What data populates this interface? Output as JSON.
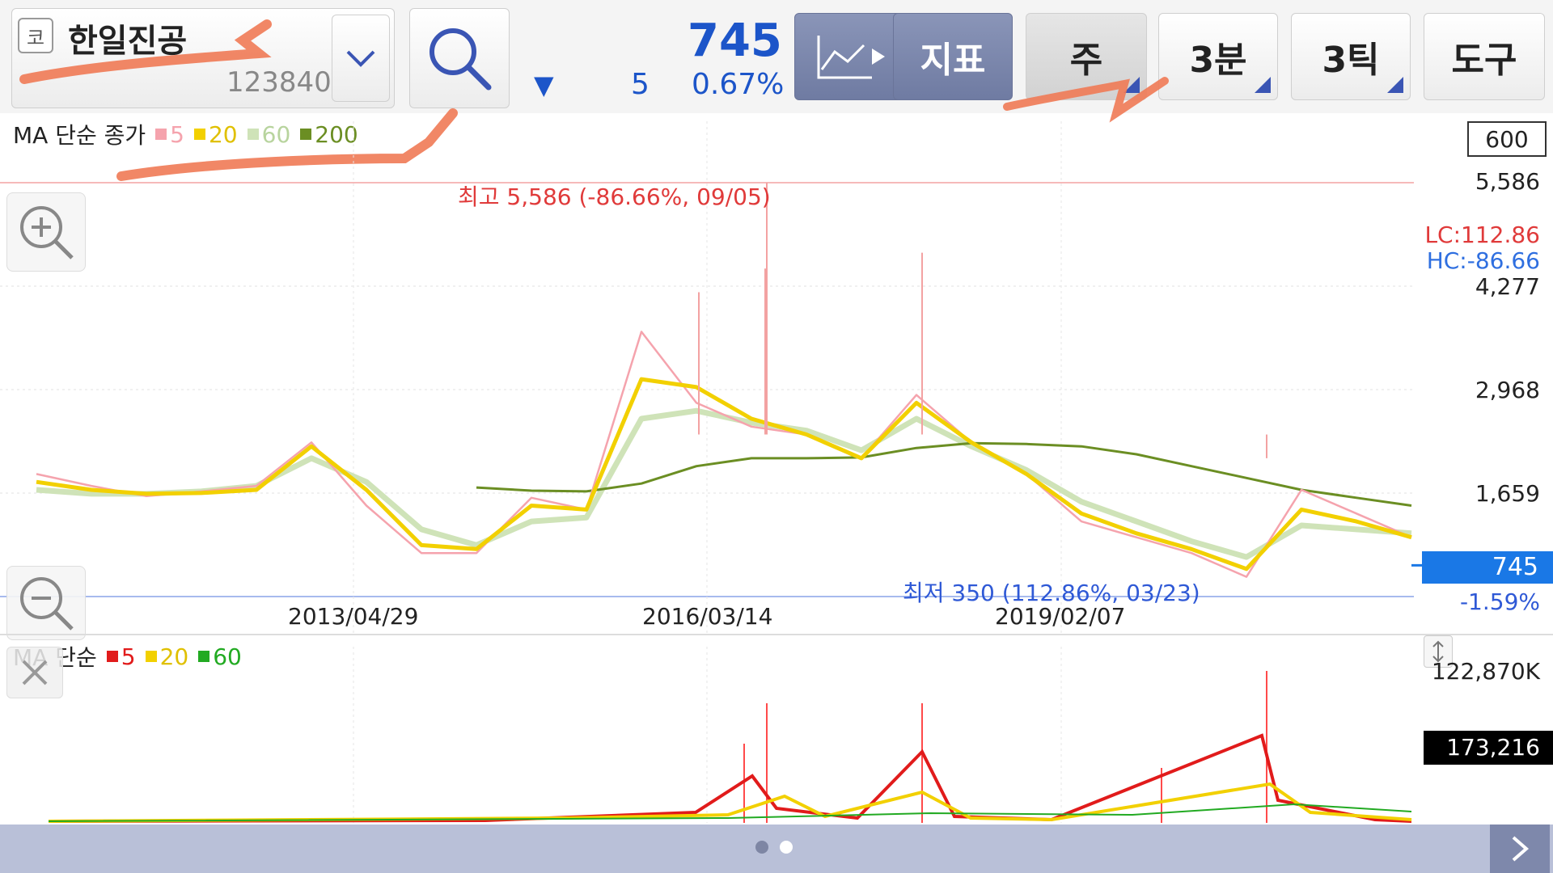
{
  "toolbar": {
    "market_badge": "코",
    "stock_name": "한일진공",
    "stock_code": "123840",
    "price": "745",
    "change_arrow": "▼",
    "change_value": "5",
    "change_pct": "0.67%",
    "buttons": {
      "indicator": "지표",
      "period_week": "주",
      "minute": "3분",
      "tick": "3틱",
      "tools": "도구"
    }
  },
  "price_chart": {
    "legend": {
      "title": "MA 단순 종가",
      "items": [
        {
          "label": "5",
          "color": "#f5a3ad"
        },
        {
          "label": "20",
          "color": "#f2d000"
        },
        {
          "label": "60",
          "color": "#cfe3b8"
        },
        {
          "label": "200",
          "color": "#6b8e23"
        }
      ]
    },
    "count_box": "600",
    "high_label": "최고 5,586 (-86.66%, 09/05)",
    "low_label": "최저 350 (112.86%, 03/23)",
    "lc_label": "LC:112.86",
    "hc_label": "HC:-86.66",
    "y_ticks": [
      "5,586",
      "4,277",
      "2,968",
      "1,659"
    ],
    "current_price_tag": "745",
    "current_change_pct": "-1.59%",
    "x_ticks": [
      "2013/04/29",
      "2016/03/14",
      "2019/02/07"
    ]
  },
  "volume_chart": {
    "legend": {
      "title": "MA 단순",
      "items": [
        {
          "label": "5",
          "color": "#e11b1b"
        },
        {
          "label": "20",
          "color": "#f2d000"
        },
        {
          "label": "60",
          "color": "#22aa22"
        }
      ]
    },
    "max_label": "122,870K",
    "current_volume_tag": "173,216"
  },
  "chart_data": {
    "type": "line",
    "x_ticks": [
      "2013/04/29",
      "2016/03/14",
      "2019/02/07"
    ],
    "y_ticks": [
      5586,
      4277,
      2968,
      1659
    ],
    "high": 5586,
    "low": 350,
    "last": 745,
    "series": [
      {
        "name": "5",
        "values": [
          1900,
          1750,
          1620,
          1680,
          1750,
          2300,
          1500,
          900,
          900,
          1600,
          1450,
          3700,
          2800,
          2500,
          2400,
          2100,
          2900,
          2300,
          1900,
          1300,
          1100,
          900,
          600,
          1700,
          1400,
          1100
        ]
      },
      {
        "name": "20",
        "values": [
          1800,
          1700,
          1650,
          1660,
          1700,
          2250,
          1700,
          1000,
          950,
          1500,
          1450,
          3100,
          3000,
          2600,
          2400,
          2100,
          2800,
          2300,
          1900,
          1400,
          1150,
          950,
          700,
          1450,
          1300,
          1100
        ]
      },
      {
        "name": "60",
        "values": [
          1700,
          1650,
          1650,
          1680,
          1750,
          2100,
          1800,
          1200,
          1000,
          1300,
          1350,
          2600,
          2700,
          2550,
          2450,
          2200,
          2600,
          2250,
          1950,
          1550,
          1300,
          1050,
          850,
          1250,
          1200,
          1150
        ]
      },
      {
        "name": "200",
        "values": [
          null,
          null,
          null,
          null,
          null,
          null,
          null,
          null,
          1730,
          1690,
          1680,
          1780,
          2000,
          2100,
          2100,
          2110,
          2230,
          2290,
          2280,
          2250,
          2150,
          2000,
          1850,
          1700,
          1600,
          1500
        ]
      }
    ]
  }
}
